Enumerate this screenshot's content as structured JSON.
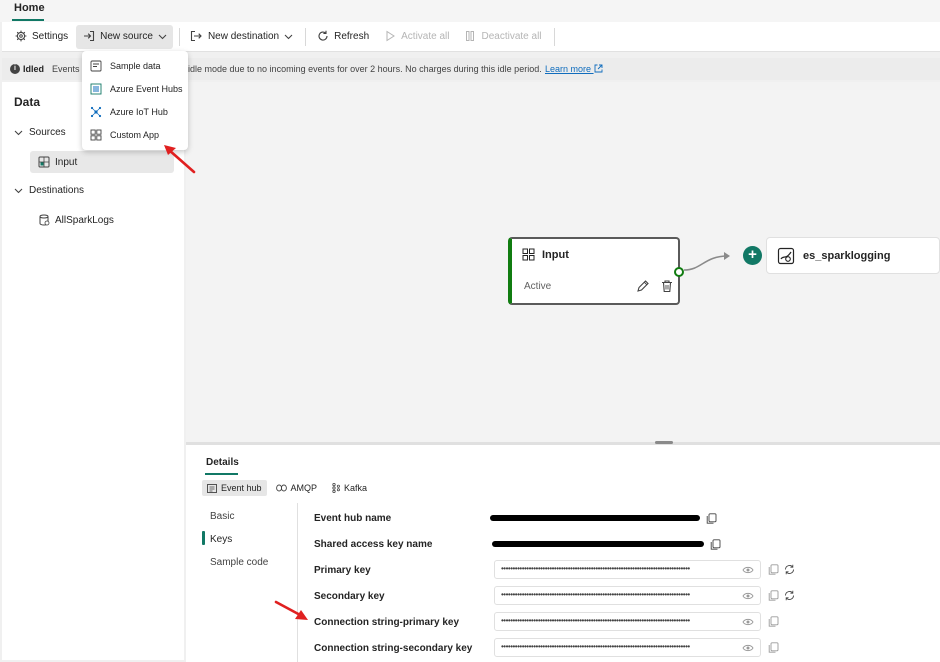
{
  "tabs": {
    "home": "Home"
  },
  "toolbar": {
    "settings": "Settings",
    "new_source": "New source",
    "new_destination": "New destination",
    "refresh": "Refresh",
    "activate_all": "Activate all",
    "deactivate_all": "Deactivate all"
  },
  "source_menu": {
    "items": [
      "Sample data",
      "Azure Event Hubs",
      "Azure IoT Hub",
      "Custom App"
    ]
  },
  "infobar": {
    "status": "Idled",
    "events_prefix": "Events",
    "message": "idle mode due to no incoming events for over 2 hours. No charges during this idle period.",
    "learn_more": "Learn more"
  },
  "left_panel": {
    "title": "Data",
    "sources_label": "Sources",
    "sources": [
      "Input"
    ],
    "destinations_label": "Destinations",
    "destinations": [
      "AllSparkLogs"
    ]
  },
  "canvas": {
    "input_node": {
      "title": "Input",
      "status": "Active"
    },
    "destination_node": {
      "title": "es_sparklogging"
    },
    "add_symbol": "+"
  },
  "details": {
    "title": "Details",
    "tabs": [
      "Event hub",
      "AMQP",
      "Kafka"
    ],
    "nav": [
      "Basic",
      "Keys",
      "Sample code"
    ],
    "fields": {
      "event_hub_name": "Event hub name",
      "shared_access_key_name": "Shared access key name",
      "primary_key": "Primary key",
      "secondary_key": "Secondary key",
      "conn_primary": "Connection string-primary key",
      "conn_secondary": "Connection string-secondary key"
    },
    "masked_value": "••••••••••••••••••••••••••••••••••••••••••••••••••••••••••••••••••••••••••••••••••"
  },
  "colors": {
    "accent": "#117865",
    "active_green": "#107c10",
    "annotation_red": "#e02020"
  }
}
